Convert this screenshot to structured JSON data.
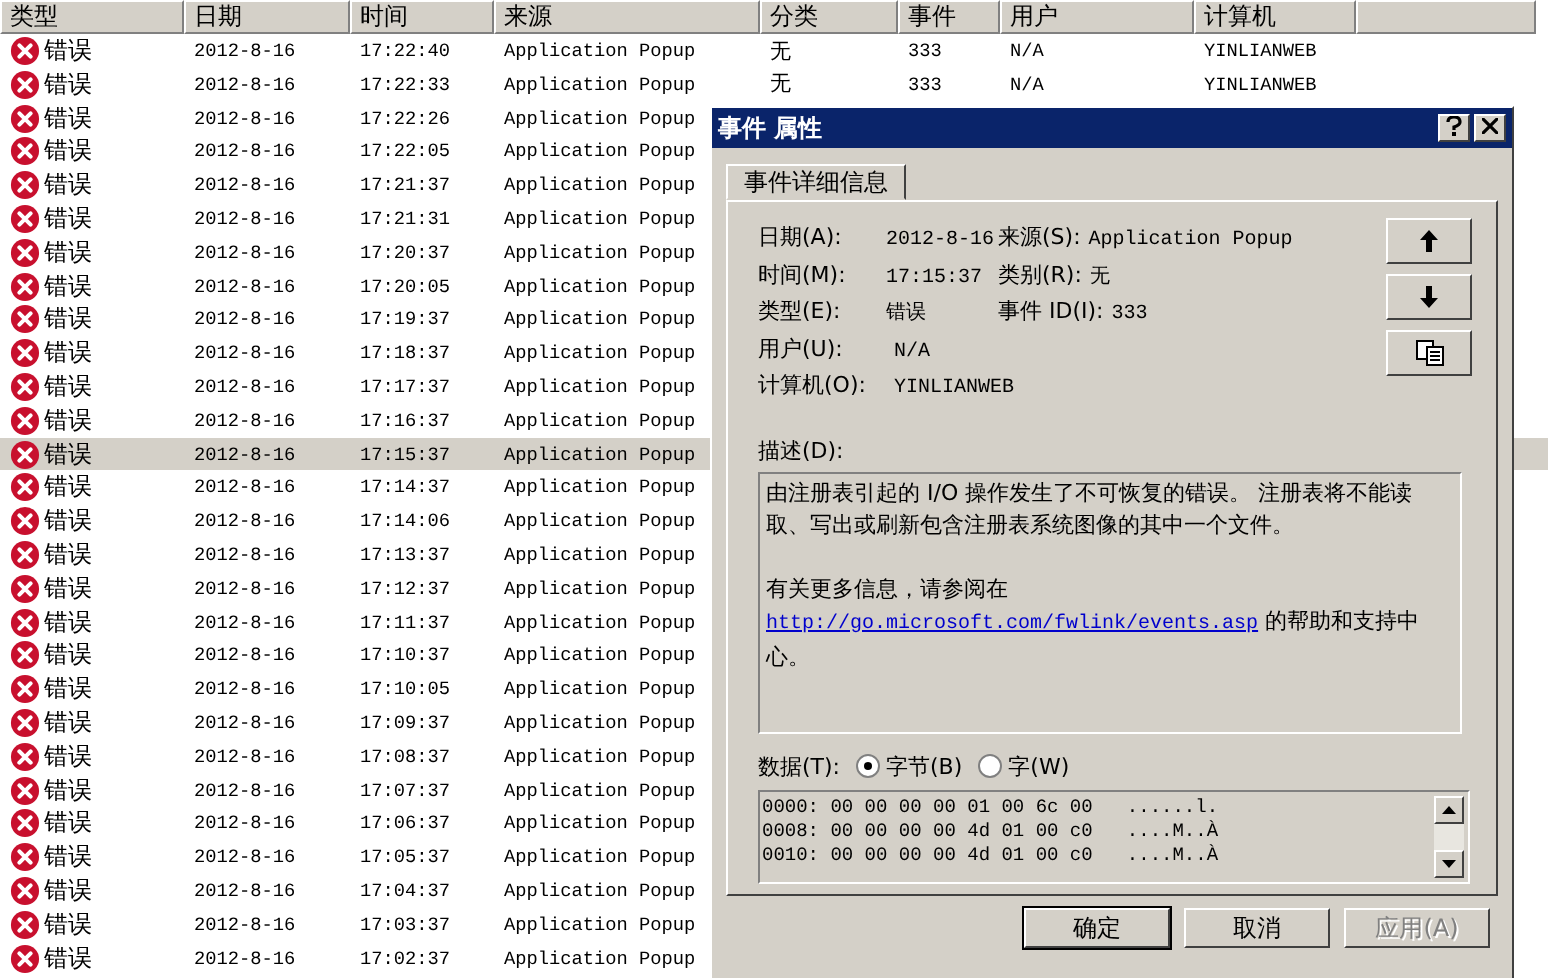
{
  "columns": [
    "类型",
    "日期",
    "时间",
    "来源",
    "分类",
    "事件",
    "用户",
    "计算机"
  ],
  "rows": [
    {
      "type": "错误",
      "date": "2012-8-16",
      "time": "17:22:40",
      "source": "Application Popup",
      "category": "无",
      "event": "333",
      "user": "N/A",
      "computer": "YINLIANWEB",
      "selected": false
    },
    {
      "type": "错误",
      "date": "2012-8-16",
      "time": "17:22:33",
      "source": "Application Popup",
      "category": "无",
      "event": "333",
      "user": "N/A",
      "computer": "YINLIANWEB",
      "selected": false
    },
    {
      "type": "错误",
      "date": "2012-8-16",
      "time": "17:22:26",
      "source": "Application Popup",
      "selected": false
    },
    {
      "type": "错误",
      "date": "2012-8-16",
      "time": "17:22:05",
      "source": "Application Popup",
      "selected": false
    },
    {
      "type": "错误",
      "date": "2012-8-16",
      "time": "17:21:37",
      "source": "Application Popup",
      "selected": false
    },
    {
      "type": "错误",
      "date": "2012-8-16",
      "time": "17:21:31",
      "source": "Application Popup",
      "selected": false
    },
    {
      "type": "错误",
      "date": "2012-8-16",
      "time": "17:20:37",
      "source": "Application Popup",
      "selected": false
    },
    {
      "type": "错误",
      "date": "2012-8-16",
      "time": "17:20:05",
      "source": "Application Popup",
      "selected": false
    },
    {
      "type": "错误",
      "date": "2012-8-16",
      "time": "17:19:37",
      "source": "Application Popup",
      "selected": false
    },
    {
      "type": "错误",
      "date": "2012-8-16",
      "time": "17:18:37",
      "source": "Application Popup",
      "selected": false
    },
    {
      "type": "错误",
      "date": "2012-8-16",
      "time": "17:17:37",
      "source": "Application Popup",
      "selected": false
    },
    {
      "type": "错误",
      "date": "2012-8-16",
      "time": "17:16:37",
      "source": "Application Popup",
      "selected": false
    },
    {
      "type": "错误",
      "date": "2012-8-16",
      "time": "17:15:37",
      "source": "Application Popup",
      "selected": true
    },
    {
      "type": "错误",
      "date": "2012-8-16",
      "time": "17:14:37",
      "source": "Application Popup",
      "selected": false
    },
    {
      "type": "错误",
      "date": "2012-8-16",
      "time": "17:14:06",
      "source": "Application Popup",
      "selected": false
    },
    {
      "type": "错误",
      "date": "2012-8-16",
      "time": "17:13:37",
      "source": "Application Popup",
      "selected": false
    },
    {
      "type": "错误",
      "date": "2012-8-16",
      "time": "17:12:37",
      "source": "Application Popup",
      "selected": false
    },
    {
      "type": "错误",
      "date": "2012-8-16",
      "time": "17:11:37",
      "source": "Application Popup",
      "selected": false
    },
    {
      "type": "错误",
      "date": "2012-8-16",
      "time": "17:10:37",
      "source": "Application Popup",
      "selected": false
    },
    {
      "type": "错误",
      "date": "2012-8-16",
      "time": "17:10:05",
      "source": "Application Popup",
      "selected": false
    },
    {
      "type": "错误",
      "date": "2012-8-16",
      "time": "17:09:37",
      "source": "Application Popup",
      "selected": false
    },
    {
      "type": "错误",
      "date": "2012-8-16",
      "time": "17:08:37",
      "source": "Application Popup",
      "selected": false
    },
    {
      "type": "错误",
      "date": "2012-8-16",
      "time": "17:07:37",
      "source": "Application Popup",
      "selected": false
    },
    {
      "type": "错误",
      "date": "2012-8-16",
      "time": "17:06:37",
      "source": "Application Popup",
      "selected": false
    },
    {
      "type": "错误",
      "date": "2012-8-16",
      "time": "17:05:37",
      "source": "Application Popup",
      "selected": false
    },
    {
      "type": "错误",
      "date": "2012-8-16",
      "time": "17:04:37",
      "source": "Application Popup",
      "selected": false
    },
    {
      "type": "错误",
      "date": "2012-8-16",
      "time": "17:03:37",
      "source": "Application Popup",
      "selected": false
    },
    {
      "type": "错误",
      "date": "2012-8-16",
      "time": "17:02:37",
      "source": "Application Popup",
      "selected": false
    }
  ],
  "dialog": {
    "title": "事件 属性",
    "tabs": [
      {
        "label": "事件详细信息",
        "selected": true
      }
    ],
    "details": [
      [
        {
          "label": "日期(A):",
          "value": "2012-8-16"
        },
        {
          "label": "来源(S):",
          "value": "Application Popup"
        }
      ],
      [
        {
          "label": "时间(M):",
          "value": "17:15:37"
        },
        {
          "label": "类别(R):",
          "value": "无"
        }
      ],
      [
        {
          "label": "类型(E):",
          "value": "错误"
        },
        {
          "label": "事件 ID(I):",
          "value": "333"
        }
      ],
      [
        {
          "label": "用户(U):",
          "value": "N/A"
        }
      ],
      [
        {
          "label": "计算机(O):",
          "value": "YINLIANWEB"
        }
      ]
    ],
    "description_label": "描述(D):",
    "description": {
      "text": "由注册表引起的 I/O 操作发生了不可恢复的错误。 注册表将不能读取、写出或刷新包含注册表系统图像的其中一个文件。",
      "more_info": "有关更多信息，请参阅在",
      "link": "http://go.microsoft.com/fwlink/events.asp",
      "link_suffix": "的帮助和支持中心。"
    },
    "data_label": "数据(T):",
    "radios": [
      {
        "label": "字节(B)",
        "selected": true
      },
      {
        "label": "字(W)",
        "selected": false
      }
    ],
    "hex_lines": [
      "0000: 00 00 00 00 01 00 6c 00   ......l.",
      "0008: 00 00 00 00 4d 01 00 c0   ....M..À",
      "0010: 00 00 00 00 4d 01 00 c0   ....M..À"
    ],
    "buttons": [
      {
        "label": "确定",
        "disabled": false,
        "default": true
      },
      {
        "label": "取消",
        "disabled": false,
        "default": false
      },
      {
        "label": "应用(A)",
        "disabled": true,
        "default": false
      }
    ]
  }
}
